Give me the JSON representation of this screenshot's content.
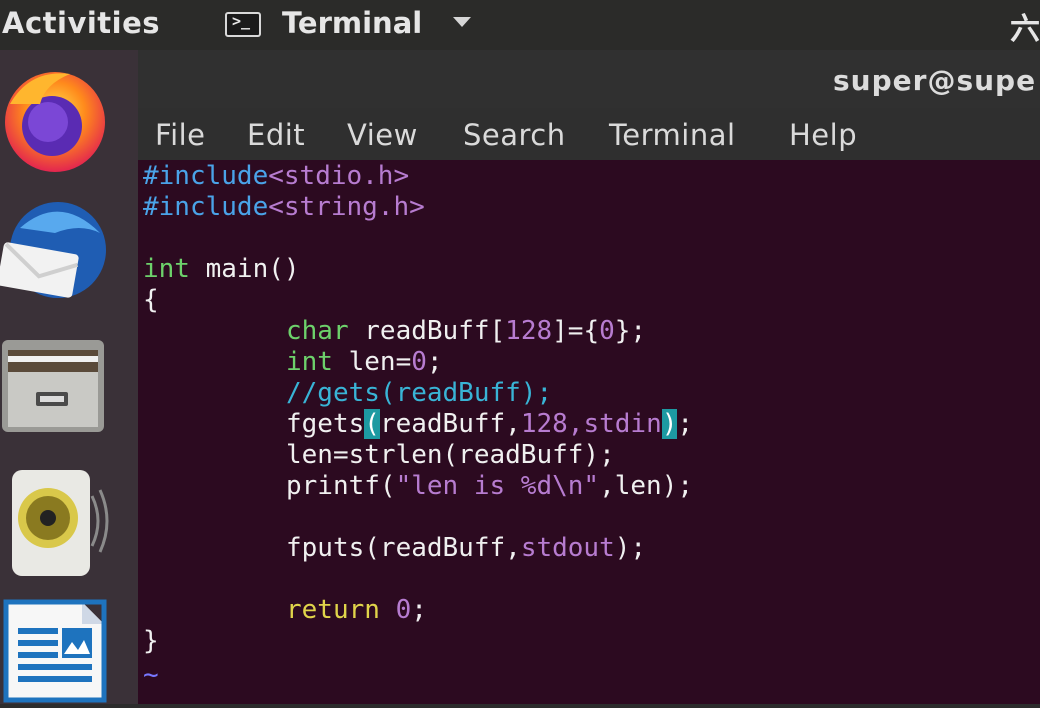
{
  "topbar": {
    "activities_label": "Activities",
    "app_name": "Terminal",
    "clock_text": "六"
  },
  "window": {
    "title": "super@supe"
  },
  "menu": {
    "items": [
      "File",
      "Edit",
      "View",
      "Search",
      "Terminal",
      "Help"
    ]
  },
  "editor": {
    "line1": {
      "directive": "#include",
      "header": "<stdio.h>"
    },
    "line2": {
      "directive": "#include",
      "header": "<string.h>"
    },
    "line4": {
      "type": "int",
      "rest": " main()"
    },
    "line5": "{",
    "line6": {
      "type": "char",
      "mid": " readBuff[",
      "num": "128",
      "rest": "]={",
      "num2": "0",
      "end": "};"
    },
    "line7": {
      "type": "int",
      "mid": " len=",
      "num": "0",
      "end": ";"
    },
    "line8": {
      "comment": "//gets(readBuff);"
    },
    "line9": {
      "fn": "fgets",
      "open": "(",
      "args1": "readBuff,",
      "num": "128",
      "args2": ",stdin",
      "close": ")",
      "end": ";"
    },
    "line10": "len=strlen(readBuff);",
    "line11": {
      "fn": "printf(",
      "str": "\"len is %d\\n\"",
      "rest": ",len);"
    },
    "line13": {
      "fn": "fputs(readBuff,",
      "arg": "stdout",
      "end": ");"
    },
    "line15": {
      "kw": "return",
      "sp": " ",
      "num": "0",
      "end": ";"
    },
    "line16": "}",
    "tilde": "~"
  },
  "dock": {
    "items": [
      {
        "icon": "firefox-icon"
      },
      {
        "icon": "thunderbird-icon"
      },
      {
        "icon": "files-icon"
      },
      {
        "icon": "rhythmbox-icon"
      },
      {
        "icon": "libreoffice-writer-icon"
      }
    ]
  },
  "colors": {
    "editor_bg": "#2c0a20",
    "keyword": "#6dd16b",
    "number": "#b77cd0",
    "comment": "#39b4d6",
    "return": "#e0d44a",
    "match_highlight": "#1d9aa2"
  }
}
